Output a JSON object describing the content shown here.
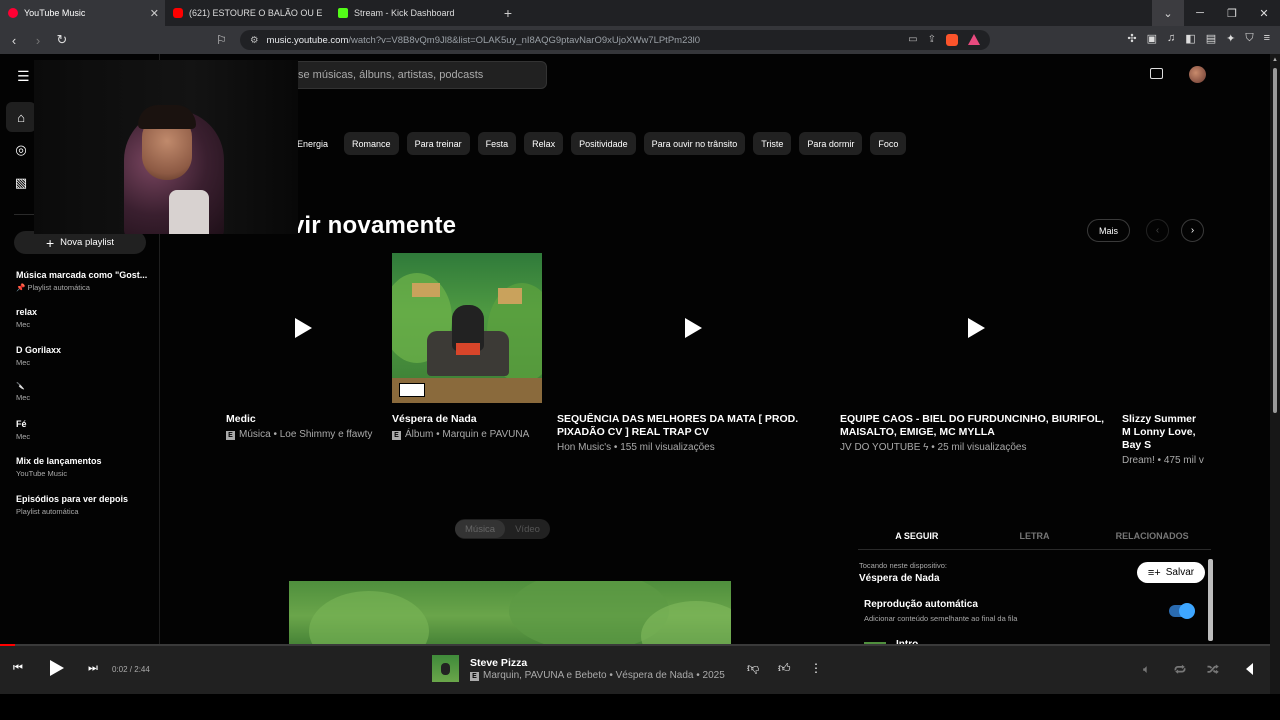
{
  "browser": {
    "tabs": [
      {
        "title": "YouTube Music",
        "favicon_color": "#ff0033",
        "active": true
      },
      {
        "title": "(621) ESTOURE O BALÃO OU ENCON",
        "favicon_color": "#ff0000",
        "active": false
      },
      {
        "title": "Stream - Kick Dashboard",
        "favicon_color": "#53fc18",
        "active": false
      }
    ],
    "new_tab": "+",
    "url_host": "music.youtube.com",
    "url_path": "/watch?v=V8B8vQm9Jl8&list=OLAK5uy_nI8AQG9ptavNarO9xUjoXWw7LPtPm23l0"
  },
  "header": {
    "search_placeholder": "se músicas, álbuns, artistas, podcasts"
  },
  "sidebar": {
    "new_playlist": "Nova playlist",
    "playlists": [
      {
        "title": "Música marcada como \"Gost...",
        "sub": "Playlist automática",
        "pinned": true
      },
      {
        "title": "relax",
        "sub": "Mec"
      },
      {
        "title": "D Gorilaxx",
        "sub": "Mec"
      },
      {
        "title": "🔪",
        "sub": "Mec"
      },
      {
        "title": "Fé",
        "sub": "Mec"
      },
      {
        "title": "Mix de lançamentos",
        "sub": "YouTube Music"
      },
      {
        "title": "Episódios para ver depois",
        "sub": "Playlist automática"
      }
    ]
  },
  "chips": [
    "Energia",
    "Romance",
    "Para treinar",
    "Festa",
    "Relax",
    "Positividade",
    "Para ouvir no trânsito",
    "Triste",
    "Para dormir",
    "Foco"
  ],
  "section": {
    "title": "uvir novamente",
    "more": "Mais"
  },
  "cards": [
    {
      "title": "Medic",
      "sub": "Música • Loe Shimmy e ffawty",
      "explicit": true
    },
    {
      "title": "Véspera de Nada",
      "sub": "Álbum • Marquin e PAVUNA",
      "explicit": true
    },
    {
      "title": "SEQUÊNCIA DAS MELHORES DA MATA [ PROD. PIXADÃO CV ] REAL TRAP CV",
      "sub": "Hon Music's • 155 mil visualizações",
      "explicit": false
    },
    {
      "title": "EQUIPE CAOS - BIEL DO FURDUNCINHO, BIURIFOL, MAISALTO, EMIGE, MC MYLLA",
      "sub": "JV DO YOUTUBE ϟ • 25 mil visualizações",
      "explicit": false
    },
    {
      "title": "Slizzy Summer M Lonny Love, Bay S",
      "sub": "Dream! • 475 mil v",
      "explicit": false
    }
  ],
  "player_toggle": {
    "music": "Música",
    "video": "Vídeo"
  },
  "panel": {
    "tabs": [
      "A SEGUIR",
      "LETRA",
      "RELACIONADOS"
    ],
    "playing_on": "Tocando neste dispositivo:",
    "playing_title": "Véspera de Nada",
    "save": "Salvar",
    "autoplay_title": "Reprodução automática",
    "autoplay_sub": "Adicionar conteúdo semelhante ao final da fila",
    "autoplay_on": true,
    "queue_first": "Intro"
  },
  "playerbar": {
    "time": "0:02 / 2:44",
    "progress": 0.012,
    "title": "Steve Pizza",
    "sub": "Marquin, PAVUNA e Bebeto • Véspera de Nada • 2025"
  }
}
